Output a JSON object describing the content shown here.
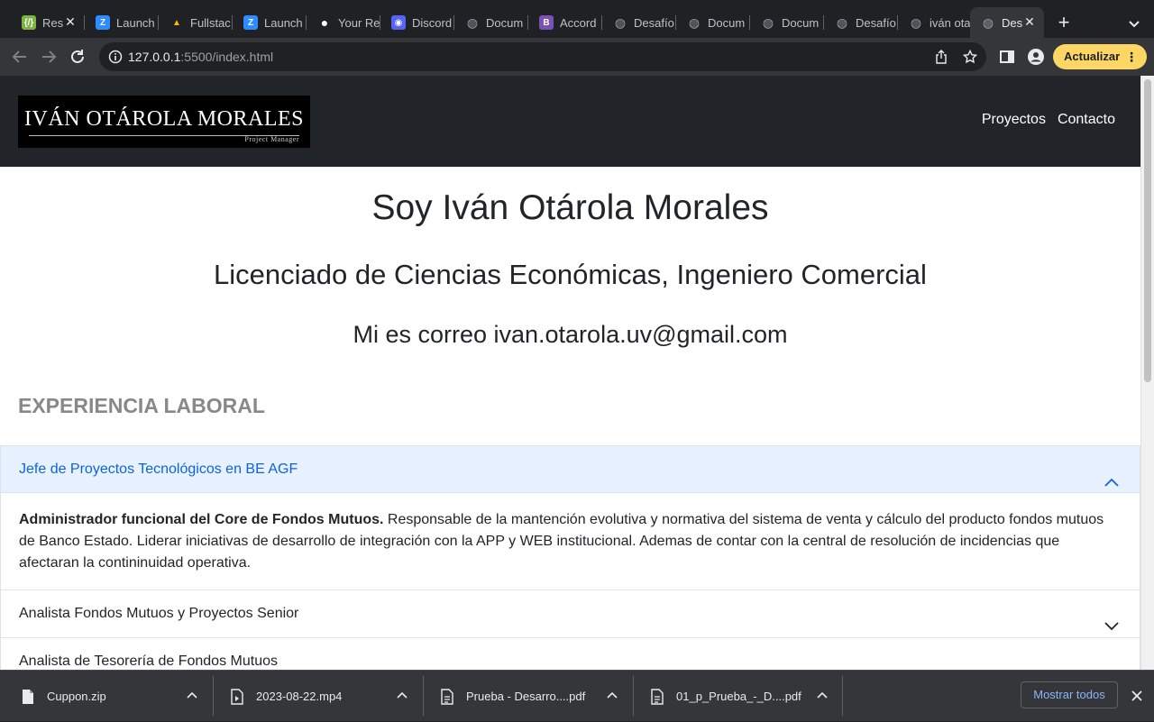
{
  "browser": {
    "tabs": [
      {
        "label": "Res",
        "icon": "replit-icon",
        "color": "#7cb342",
        "glyph": "{/}"
      },
      {
        "label": "Launch",
        "icon": "zoom-icon",
        "color": "#2d8cff",
        "glyph": "Z"
      },
      {
        "label": "Fullstac",
        "icon": "google-drive-icon",
        "color": "#fbbc04",
        "glyph": "▲"
      },
      {
        "label": "Launch",
        "icon": "zoom-icon",
        "color": "#2d8cff",
        "glyph": "Z"
      },
      {
        "label": "Your Re",
        "icon": "github-icon",
        "color": "#ffffff",
        "glyph": "●"
      },
      {
        "label": "Discord",
        "icon": "discord-icon",
        "color": "#5865f2",
        "glyph": "◉"
      },
      {
        "label": "Docum",
        "icon": "globe-icon",
        "color": "#9aa0a6",
        "glyph": "◍"
      },
      {
        "label": "Accord",
        "icon": "bootstrap-icon",
        "color": "#7952b3",
        "glyph": "B"
      },
      {
        "label": "Desafío",
        "icon": "globe-icon",
        "color": "#9aa0a6",
        "glyph": "◍"
      },
      {
        "label": "Docum",
        "icon": "globe-icon",
        "color": "#9aa0a6",
        "glyph": "◍"
      },
      {
        "label": "Docum",
        "icon": "globe-icon",
        "color": "#9aa0a6",
        "glyph": "◍"
      },
      {
        "label": "Desafío",
        "icon": "globe-icon",
        "color": "#9aa0a6",
        "glyph": "◍"
      },
      {
        "label": "iván ota",
        "icon": "globe-icon",
        "color": "#9aa0a6",
        "glyph": "◍"
      },
      {
        "label": "Des",
        "icon": "globe-icon",
        "color": "#9aa0a6",
        "glyph": "◍"
      }
    ],
    "new_tab": "+",
    "url_host": "127.0.0.1",
    "url_rest": ":5500/index.html",
    "update_label": "Actualizar"
  },
  "site": {
    "logo_name": "IVÁN OTÁROLA MORALES",
    "logo_subtitle": "Project Manager",
    "nav": [
      "Proyectos",
      "Contacto"
    ],
    "title": "Soy Iván Otárola Morales",
    "subtitle": "Licenciado de Ciencias Económicas, Ingeniero Comercial",
    "email_line": "Mi es correo ivan.otarola.uv@gmail.com",
    "section_title": "EXPERIENCIA LABORAL",
    "accordion": [
      {
        "title": "Jefe de Proyectos Tecnológicos en BE AGF",
        "open": true,
        "body_strong": "Administrador funcional del Core de Fondos Mutuos.",
        "body_text": " Responsable de la mantención evolutiva y normativa del sistema de venta y cálculo del producto fondos mutuos de Banco Estado. Liderar iniciativas de desarrollo de integración con la APP y WEB institucional. Ademas de contar con la central de resolución de incidencias que afectaran la contininuidad operativa."
      },
      {
        "title": "Analista Fondos Mutuos y Proyectos Senior",
        "open": false
      },
      {
        "title": "Analista de Tesorería de Fondos Mutuos",
        "open": false
      }
    ]
  },
  "downloads": {
    "items": [
      "Cuppon.zip",
      "2023-08-22.mp4",
      "Prueba - Desarro....pdf",
      "01_p_Prueba_-_D....pdf"
    ],
    "show_all": "Mostrar todos"
  }
}
